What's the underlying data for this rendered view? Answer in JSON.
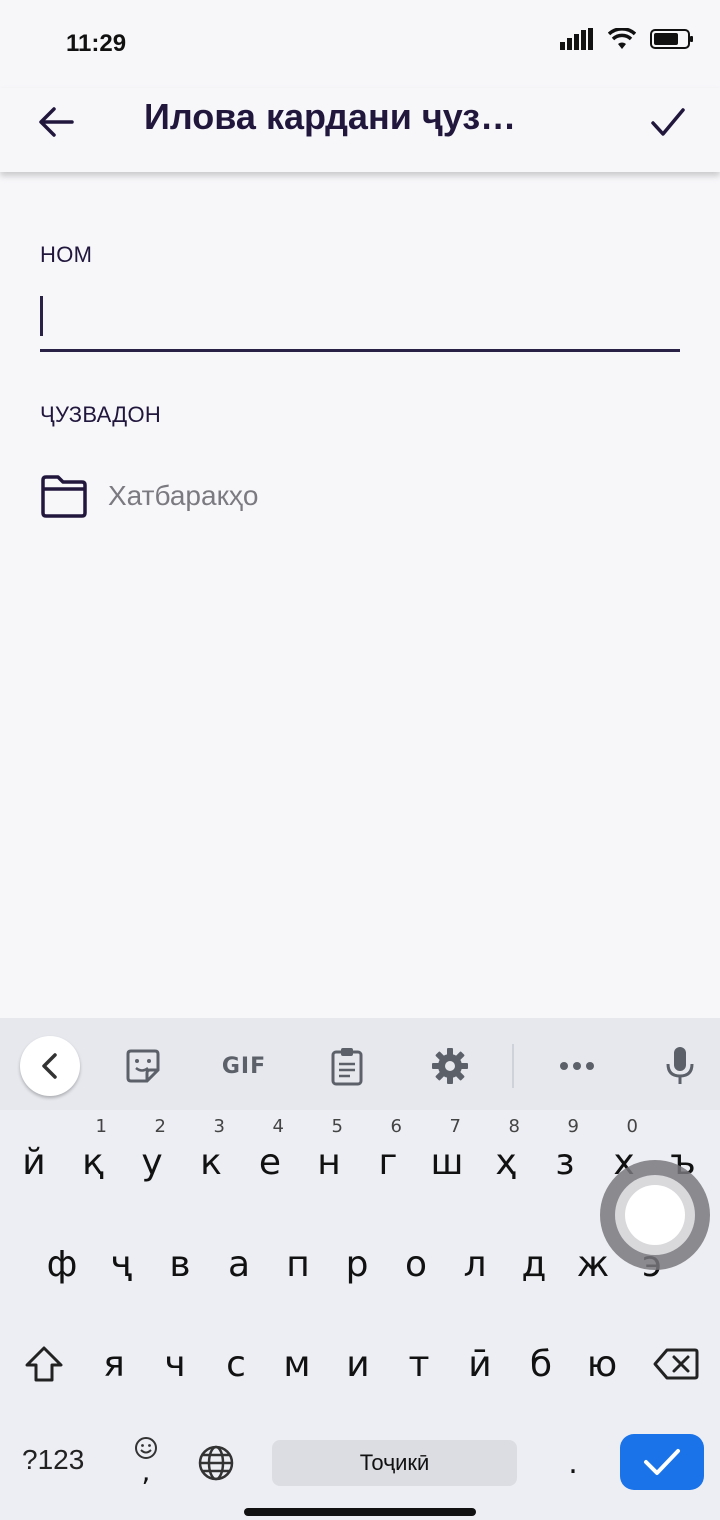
{
  "status_bar": {
    "time": "11:29"
  },
  "app_bar": {
    "title": "Илова кардани ҷуз…"
  },
  "form": {
    "name_label": "НОМ",
    "name_value": "",
    "folder_label": "ҶУЗВАДОН",
    "folder_name": "Хатбаракҳо"
  },
  "keyboard": {
    "row1": [
      "й",
      "қ",
      "у",
      "к",
      "е",
      "н",
      "г",
      "ш",
      "ҳ",
      "з",
      "х",
      "ъ"
    ],
    "row1_hints": [
      "",
      "1",
      "2",
      "3",
      "4",
      "5",
      "6",
      "7",
      "8",
      "9",
      "0",
      ""
    ],
    "row2": [
      "ф",
      "ҷ",
      "в",
      "а",
      "п",
      "р",
      "о",
      "л",
      "д",
      "ж",
      "э"
    ],
    "row3": [
      "я",
      "ч",
      "с",
      "м",
      "и",
      "т",
      "ӣ",
      "б",
      "ю"
    ],
    "symbols_label": "?123",
    "comma": ",",
    "period": ".",
    "space_label": "Тоҷикӣ",
    "toolbar": {
      "gif_label": "GIF"
    }
  },
  "colors": {
    "accent": "#21173d",
    "enter": "#1a73e8"
  }
}
